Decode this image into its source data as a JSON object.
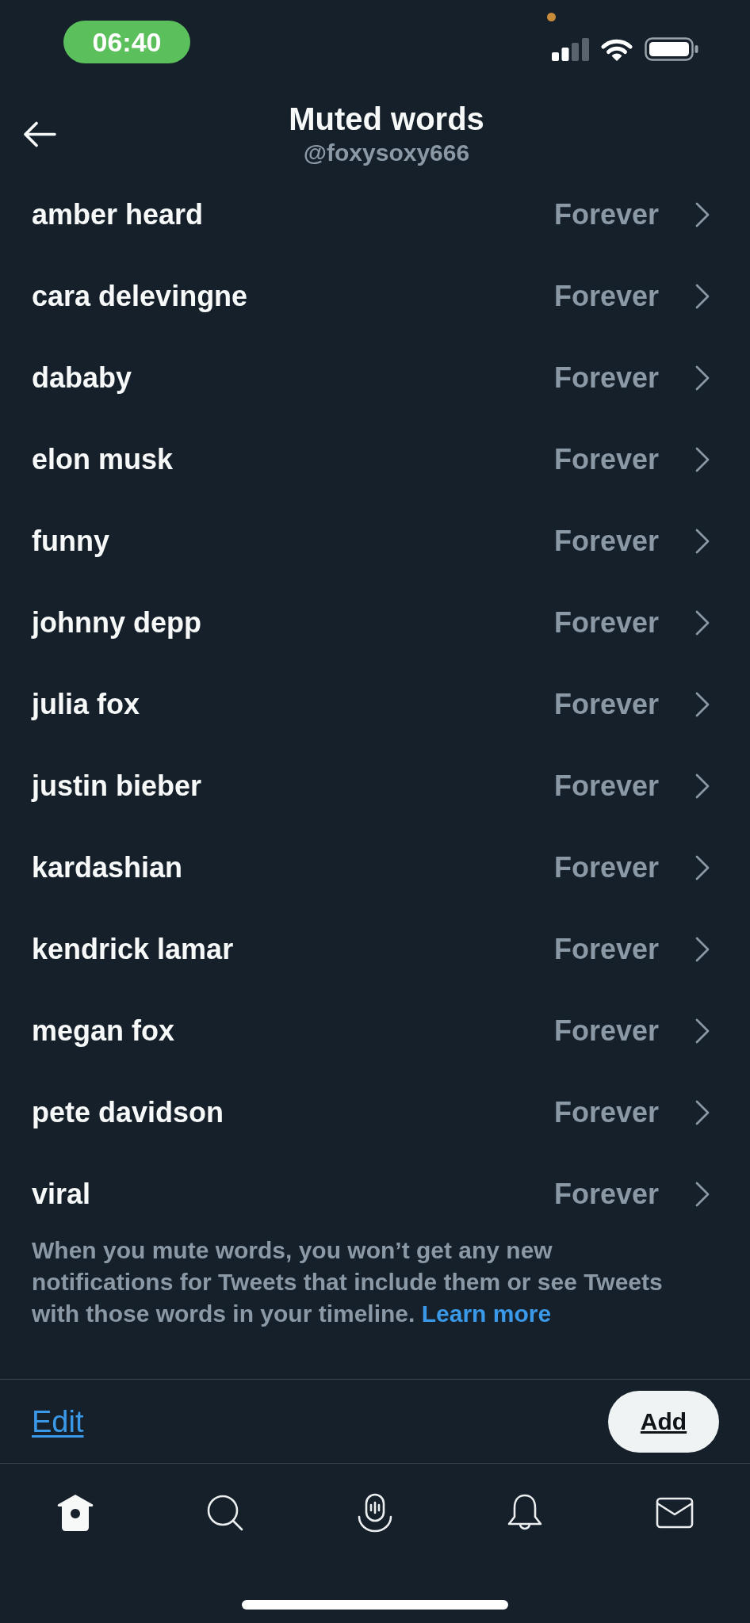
{
  "status_bar": {
    "time": "06:40"
  },
  "header": {
    "title": "Muted words",
    "subtitle": "@foxysoxy666"
  },
  "muted_words": [
    {
      "word": "amber heard",
      "duration": "Forever"
    },
    {
      "word": "cara delevingne",
      "duration": "Forever"
    },
    {
      "word": "dababy",
      "duration": "Forever"
    },
    {
      "word": "elon musk",
      "duration": "Forever"
    },
    {
      "word": "funny",
      "duration": "Forever"
    },
    {
      "word": "johnny depp",
      "duration": "Forever"
    },
    {
      "word": "julia fox",
      "duration": "Forever"
    },
    {
      "word": "justin bieber",
      "duration": "Forever"
    },
    {
      "word": "kardashian",
      "duration": "Forever"
    },
    {
      "word": "kendrick lamar",
      "duration": "Forever"
    },
    {
      "word": "megan fox",
      "duration": "Forever"
    },
    {
      "word": "pete davidson",
      "duration": "Forever"
    },
    {
      "word": "viral",
      "duration": "Forever"
    }
  ],
  "info": {
    "text": "When you mute words, you won’t get any new notifications for Tweets that include them or see Tweets with those words in your timeline.",
    "link": "Learn more"
  },
  "actions": {
    "edit": "Edit",
    "add": "Add"
  },
  "tab_bar": [
    {
      "kind": "home",
      "selected": true
    },
    {
      "kind": "search",
      "selected": false
    },
    {
      "kind": "spaces",
      "selected": false
    },
    {
      "kind": "notifications",
      "selected": false
    },
    {
      "kind": "messages",
      "selected": false
    }
  ]
}
